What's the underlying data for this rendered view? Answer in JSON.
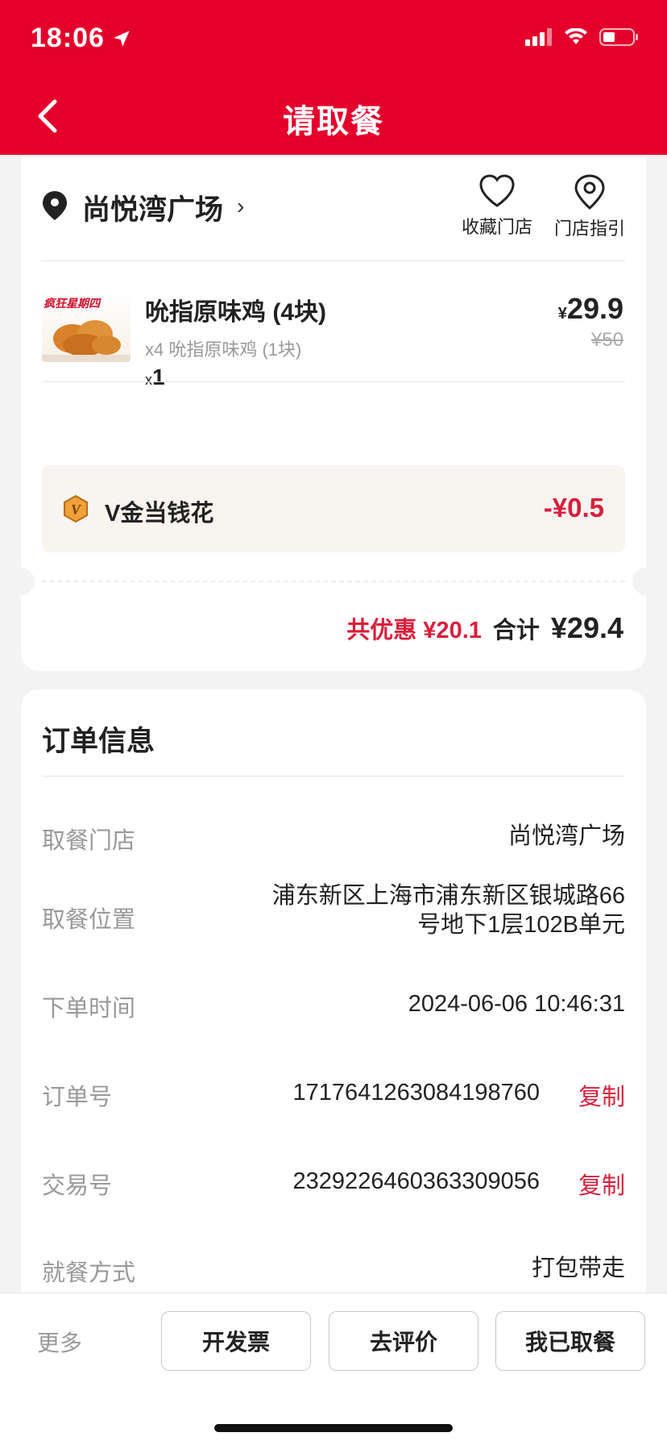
{
  "status_bar": {
    "time": "18:06"
  },
  "header": {
    "title": "请取餐"
  },
  "store": {
    "name": "尚悦湾广场",
    "favorite_label": "收藏门店",
    "guide_label": "门店指引"
  },
  "product": {
    "name": "吮指原味鸡 (4块)",
    "detail": "x4 吮指原味鸡 (1块)",
    "qty_prefix": "x",
    "qty": "1",
    "currency": "¥",
    "price": "29.9",
    "original_price": "¥50",
    "image_badge": "疯狂星期四"
  },
  "vgold": {
    "label": "V金当钱花",
    "amount": "-¥0.5"
  },
  "totals": {
    "savings": "共优惠 ¥20.1",
    "total_label": "合计",
    "total_value": "¥29.4"
  },
  "order_info": {
    "title": "订单信息",
    "rows": [
      {
        "label": "取餐门店",
        "value": "尚悦湾广场"
      },
      {
        "label": "取餐位置",
        "value_line1": "浦东新区上海市浦东新区银城路66",
        "value_line2": "号地下1层102B单元"
      },
      {
        "label": "下单时间",
        "value": "2024-06-06 10:46:31"
      },
      {
        "label": "订单号",
        "value": "1717641263084198760",
        "action": "复制"
      },
      {
        "label": "交易号",
        "value": "2329226460363309056",
        "action": "复制"
      },
      {
        "label": "就餐方式",
        "value": "打包带走"
      }
    ]
  },
  "bottom_bar": {
    "more": "更多",
    "invoice": "开发票",
    "review": "去评价",
    "picked_up": "我已取餐"
  },
  "colors": {
    "brand_red": "#e4002b",
    "accent_red": "#d81f3c"
  }
}
